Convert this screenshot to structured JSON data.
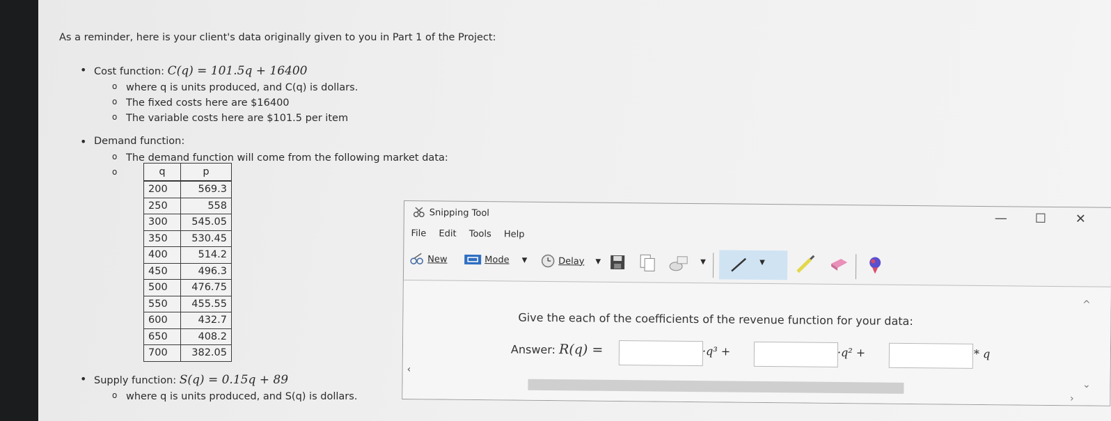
{
  "reminder": "As a reminder, here is your client's data originally given to you in Part 1 of the Project:",
  "cost": {
    "label": "Cost function:",
    "formula": "C(q) = 101.5q + 16400",
    "notes": [
      "where q is units produced, and C(q) is dollars.",
      "The fixed costs here are $16400",
      "The variable costs here are $101.5 per item"
    ]
  },
  "demand": {
    "label": "Demand function:",
    "note": "The demand function will come from the following market data:",
    "headers": [
      "q",
      "p"
    ],
    "rows": [
      [
        "200",
        "569.3"
      ],
      [
        "250",
        "558"
      ],
      [
        "300",
        "545.05"
      ],
      [
        "350",
        "530.45"
      ],
      [
        "400",
        "514.2"
      ],
      [
        "450",
        "496.3"
      ],
      [
        "500",
        "476.75"
      ],
      [
        "550",
        "455.55"
      ],
      [
        "600",
        "432.7"
      ],
      [
        "650",
        "408.2"
      ],
      [
        "700",
        "382.05"
      ]
    ]
  },
  "supply": {
    "label": "Supply function:",
    "formula": "S(q) = 0.15q + 89",
    "note": "where q is units produced, and S(q) is dollars."
  },
  "snipping_tool": {
    "title": "Snipping Tool",
    "menu": [
      "File",
      "Edit",
      "Tools",
      "Help"
    ],
    "toolbar": {
      "new": "New",
      "mode": "Mode",
      "delay": "Delay"
    },
    "window_controls": {
      "minimize": "—",
      "maximize": "☐",
      "close": "✕"
    },
    "accent": "#cfe3f3"
  },
  "question": {
    "prompt": "Give the each of the coefficients of the revenue function for your data:",
    "answer_label": "Answer:",
    "lhs": "R(q) =",
    "terms": [
      "·q³ +",
      "·q² +",
      "* q"
    ],
    "inputs": [
      "",
      "",
      ""
    ]
  }
}
